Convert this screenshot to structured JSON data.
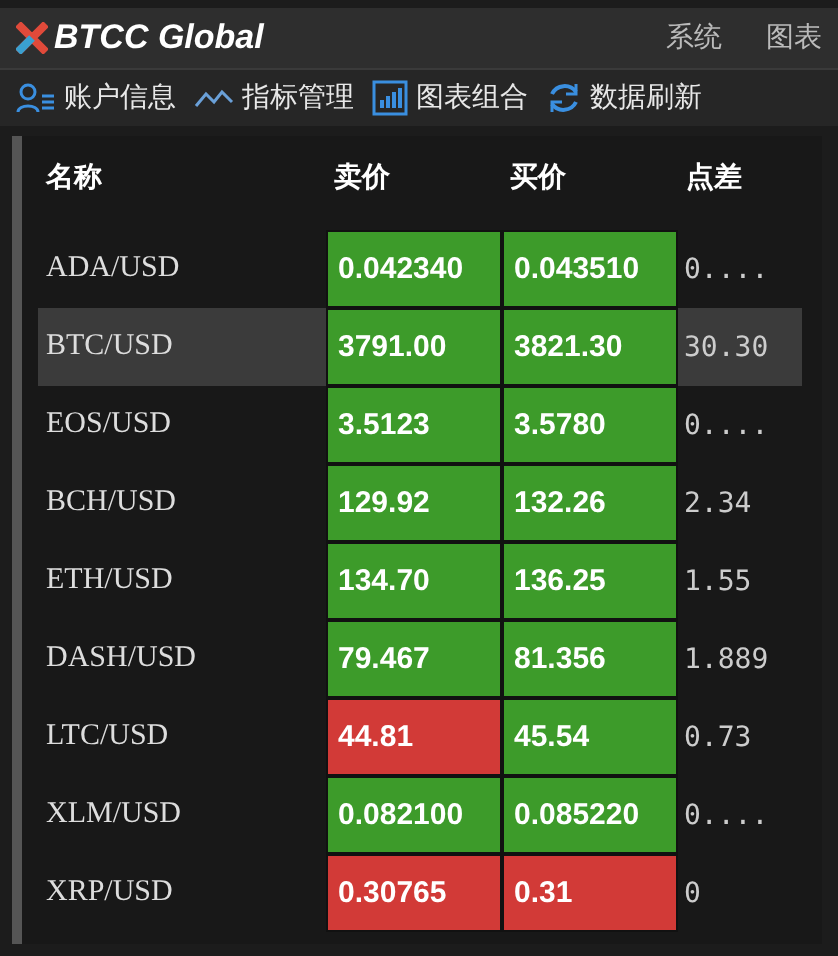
{
  "app": {
    "title": "BTCC Global",
    "menu": [
      "系统",
      "图表"
    ]
  },
  "toolbar": [
    {
      "kind": "account",
      "label": "账户信息"
    },
    {
      "kind": "indicator",
      "label": "指标管理"
    },
    {
      "kind": "chart",
      "label": "图表组合"
    },
    {
      "kind": "refresh",
      "label": "数据刷新"
    }
  ],
  "table": {
    "columns": [
      "名称",
      "卖价",
      "买价",
      "点差"
    ],
    "rows": [
      {
        "name": "ADA/USD",
        "sell": {
          "value": "0.042340",
          "color": "#3d9b2a"
        },
        "buy": {
          "value": "0.043510",
          "color": "#3d9b2a"
        },
        "spread": "0....",
        "selected": false
      },
      {
        "name": "BTC/USD",
        "sell": {
          "value": "3791.00",
          "color": "#3d9b2a"
        },
        "buy": {
          "value": "3821.30",
          "color": "#3d9b2a"
        },
        "spread": "30.30",
        "selected": true
      },
      {
        "name": "EOS/USD",
        "sell": {
          "value": "3.5123",
          "color": "#3d9b2a"
        },
        "buy": {
          "value": "3.5780",
          "color": "#3d9b2a"
        },
        "spread": "0....",
        "selected": false
      },
      {
        "name": "BCH/USD",
        "sell": {
          "value": "129.92",
          "color": "#3d9b2a"
        },
        "buy": {
          "value": "132.26",
          "color": "#3d9b2a"
        },
        "spread": "2.34",
        "selected": false
      },
      {
        "name": "ETH/USD",
        "sell": {
          "value": "134.70",
          "color": "#3d9b2a"
        },
        "buy": {
          "value": "136.25",
          "color": "#3d9b2a"
        },
        "spread": "1.55",
        "selected": false
      },
      {
        "name": "DASH/USD",
        "sell": {
          "value": "79.467",
          "color": "#3d9b2a"
        },
        "buy": {
          "value": "81.356",
          "color": "#3d9b2a"
        },
        "spread": "1.889",
        "selected": false
      },
      {
        "name": "LTC/USD",
        "sell": {
          "value": "44.81",
          "color": "#d23a37"
        },
        "buy": {
          "value": "45.54",
          "color": "#3d9b2a"
        },
        "spread": "0.73",
        "selected": false
      },
      {
        "name": "XLM/USD",
        "sell": {
          "value": "0.082100",
          "color": "#3d9b2a"
        },
        "buy": {
          "value": "0.085220",
          "color": "#3d9b2a"
        },
        "spread": "0....",
        "selected": false
      },
      {
        "name": "XRP/USD",
        "sell": {
          "value": "0.30765",
          "color": "#d23a37"
        },
        "buy": {
          "value": "0.31",
          "color": "#d23a37"
        },
        "spread": "0",
        "selected": false
      }
    ]
  }
}
